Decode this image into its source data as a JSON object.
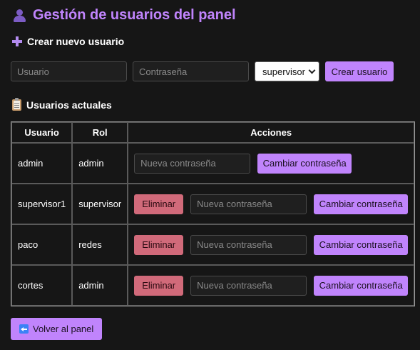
{
  "header": {
    "title": "Gestión de usuarios del panel",
    "icon": "user-icon"
  },
  "create": {
    "heading": "Crear nuevo usuario",
    "icon": "plus-icon",
    "username_placeholder": "Usuario",
    "password_placeholder": "Contraseña",
    "role_selected": "supervisor",
    "submit_label": "Crear usuario"
  },
  "current": {
    "heading": "Usuarios actuales",
    "icon": "clipboard-icon"
  },
  "table": {
    "columns": [
      "Usuario",
      "Rol",
      "Acciones"
    ],
    "delete_label": "Eliminar",
    "password_placeholder": "Nueva contraseña",
    "change_label": "Cambiar contraseña",
    "rows": [
      {
        "user": "admin",
        "role": "admin"
      },
      {
        "user": "supervisor1",
        "role": "supervisor"
      },
      {
        "user": "paco",
        "role": "redes"
      },
      {
        "user": "cortes",
        "role": "admin"
      }
    ]
  },
  "back": {
    "label": "Volver al panel",
    "icon": "back-arrow-icon"
  },
  "colors": {
    "accent": "#c084fc",
    "danger": "#d16a7a",
    "background": "#161616"
  }
}
